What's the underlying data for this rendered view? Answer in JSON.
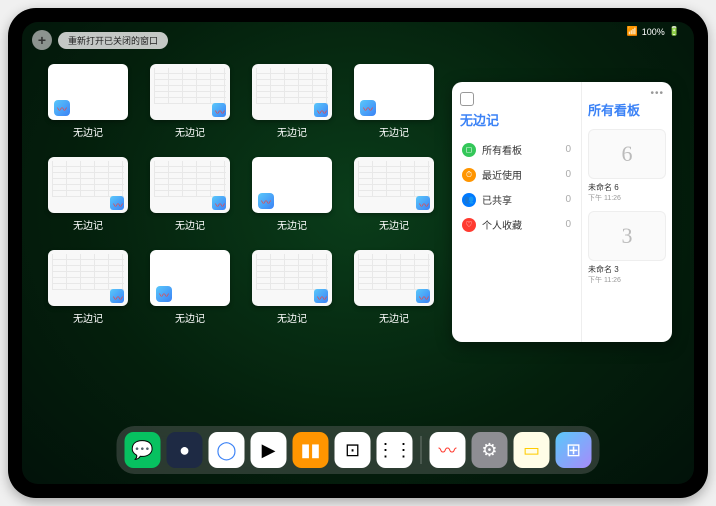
{
  "status": {
    "battery": "100%"
  },
  "top": {
    "plus": "+",
    "reopen_label": "重新打开已关闭的窗口"
  },
  "app_name": "无边记",
  "windows": [
    {
      "type": "blank"
    },
    {
      "type": "content"
    },
    {
      "type": "content"
    },
    {
      "type": "blank"
    },
    {
      "type": "content"
    },
    {
      "type": "content"
    },
    {
      "type": "blank"
    },
    {
      "type": "content"
    },
    {
      "type": "content"
    },
    {
      "type": "blank"
    },
    {
      "type": "content"
    },
    {
      "type": "content"
    }
  ],
  "panel": {
    "title_left": "无边记",
    "title_right": "所有看板",
    "categories": [
      {
        "label": "所有看板",
        "count": "0",
        "color": "#34c759",
        "glyph": "◻"
      },
      {
        "label": "最近使用",
        "count": "0",
        "color": "#ff9500",
        "glyph": "⏱"
      },
      {
        "label": "已共享",
        "count": "0",
        "color": "#007aff",
        "glyph": "👥"
      },
      {
        "label": "个人收藏",
        "count": "0",
        "color": "#ff3b30",
        "glyph": "♡"
      }
    ],
    "boards": [
      {
        "glyph": "6",
        "name": "未命名 6",
        "time": "下午 11:26"
      },
      {
        "glyph": "3",
        "name": "未命名 3",
        "time": "下午 11:26"
      }
    ]
  },
  "dock": [
    {
      "bg": "#07c160",
      "fg": "#fff",
      "glyph": "💬",
      "name": "wechat"
    },
    {
      "bg": "#1e2a44",
      "fg": "#fff",
      "glyph": "●",
      "name": "quark"
    },
    {
      "bg": "#fff",
      "fg": "#3b82f6",
      "glyph": "◯",
      "name": "browser"
    },
    {
      "bg": "#fff",
      "fg": "#000",
      "glyph": "▶",
      "name": "play"
    },
    {
      "bg": "#ff9500",
      "fg": "#fff",
      "glyph": "▮▮",
      "name": "books"
    },
    {
      "bg": "#fff",
      "fg": "#000",
      "glyph": "⊡",
      "name": "dice"
    },
    {
      "bg": "#fff",
      "fg": "#000",
      "glyph": "⋮⋮",
      "name": "dots"
    },
    {
      "sep": true
    },
    {
      "bg": "#fff",
      "fg": "#ff3b30",
      "glyph": "〰",
      "name": "freeform"
    },
    {
      "bg": "#8e8e93",
      "fg": "#fff",
      "glyph": "⚙",
      "name": "settings"
    },
    {
      "bg": "#fffde7",
      "fg": "#ffcc00",
      "glyph": "▭",
      "name": "notes"
    },
    {
      "bg": "linear-gradient(135deg,#5ac8fa,#a78bfa)",
      "fg": "#fff",
      "glyph": "⊞",
      "name": "recent"
    }
  ]
}
